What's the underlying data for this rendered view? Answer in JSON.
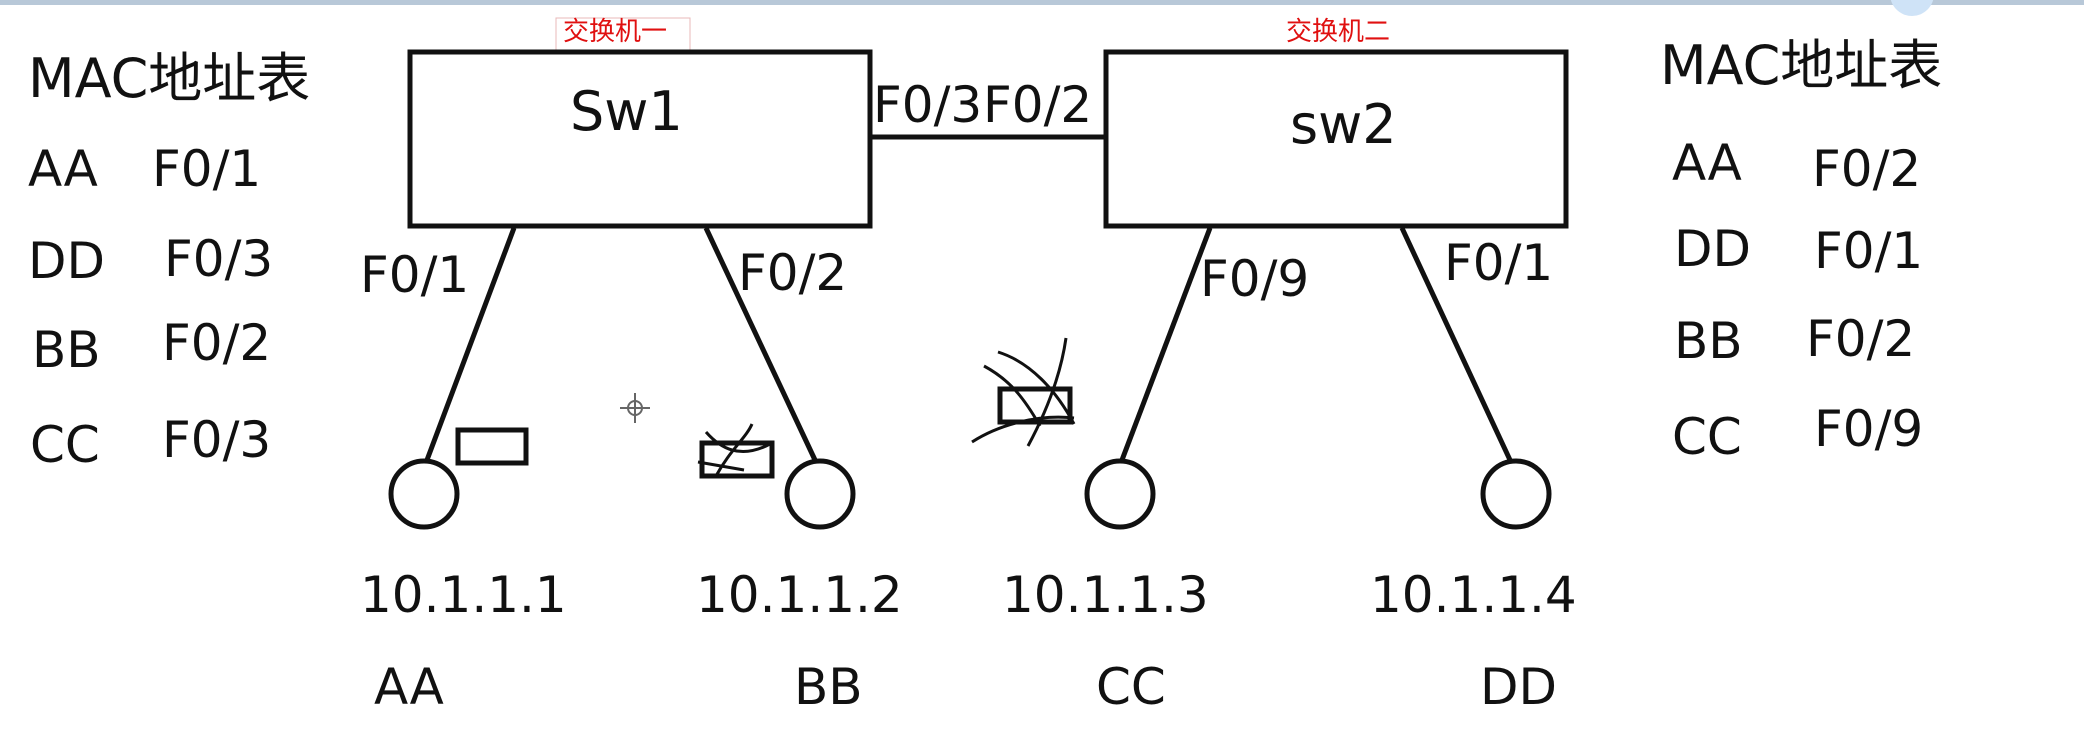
{
  "switch1": {
    "caption": "交换机一",
    "name": "Sw1",
    "uplink_port": "F0/3",
    "port_left": "F0/1",
    "port_right": "F0/2"
  },
  "switch2": {
    "caption": "交换机二",
    "name": "sw2",
    "uplink_port": "F0/2",
    "port_left": "F0/9",
    "port_right": "F0/1"
  },
  "hosts": [
    {
      "ip": "10.1.1.1",
      "mac": "AA"
    },
    {
      "ip": "10.1.1.2",
      "mac": "BB"
    },
    {
      "ip": "10.1.1.3",
      "mac": "CC"
    },
    {
      "ip": "10.1.1.4",
      "mac": "DD"
    }
  ],
  "mac_table_left": {
    "title": "MAC地址表",
    "rows": [
      {
        "mac": "AA",
        "port": "F0/1"
      },
      {
        "mac": "DD",
        "port": "F0/3"
      },
      {
        "mac": "BB",
        "port": "F0/2"
      },
      {
        "mac": "CC",
        "port": "F0/3"
      }
    ]
  },
  "mac_table_right": {
    "title": "MAC地址表",
    "rows": [
      {
        "mac": "AA",
        "port": "F0/2"
      },
      {
        "mac": "DD",
        "port": "F0/1"
      },
      {
        "mac": "BB",
        "port": "F0/2"
      },
      {
        "mac": "CC",
        "port": "F0/9"
      }
    ]
  },
  "colors": {
    "ink": "#111111",
    "caption": "#e01010",
    "top_border": "#b8c8d8"
  }
}
